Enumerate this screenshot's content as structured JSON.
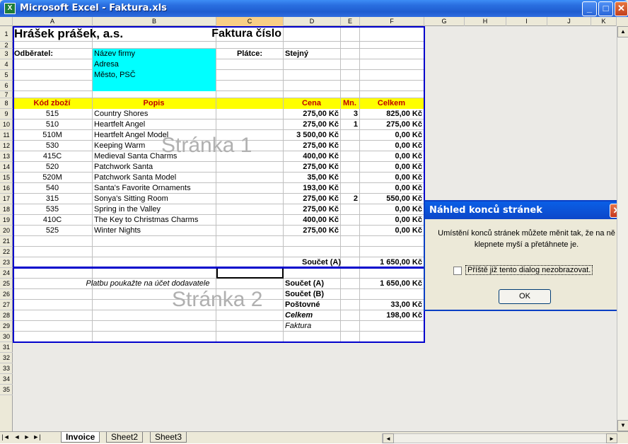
{
  "window": {
    "title": "Microsoft Excel - Faktura.xls",
    "app_icon": "X"
  },
  "columns": [
    "A",
    "B",
    "C",
    "D",
    "E",
    "F",
    "G",
    "H",
    "I",
    "J",
    "K"
  ],
  "rows": [
    "1",
    "2",
    "3",
    "4",
    "5",
    "6",
    "7",
    "8",
    "9",
    "10",
    "11",
    "12",
    "13",
    "14",
    "15",
    "16",
    "17",
    "18",
    "19",
    "20",
    "21",
    "22",
    "23",
    "24",
    "25",
    "26",
    "27",
    "28",
    "29",
    "30",
    "31",
    "32",
    "33",
    "34",
    "35"
  ],
  "header": {
    "company": "Hrášek prášek, a.s.",
    "invoice_label": "Faktura číslo"
  },
  "customer": {
    "label": "Odběratel:",
    "name": "Název firmy",
    "address": "Adresa",
    "city": "Město, PSČ",
    "payer_label": "Plátce:",
    "payer_value": "Stejný"
  },
  "table": {
    "headers": [
      "Kód zboží",
      "Popis",
      "Cena",
      "Mn.",
      "Celkem"
    ],
    "rows": [
      {
        "code": "515",
        "desc": "Country Shores",
        "price": "275,00 Kč",
        "qty": "3",
        "total": "825,00 Kč"
      },
      {
        "code": "510",
        "desc": "Heartfelt Angel",
        "price": "275,00 Kč",
        "qty": "1",
        "total": "275,00 Kč"
      },
      {
        "code": "510M",
        "desc": "Heartfelt Angel Model",
        "price": "3 500,00 Kč",
        "qty": "",
        "total": "0,00 Kč"
      },
      {
        "code": "530",
        "desc": "Keeping Warm",
        "price": "275,00 Kč",
        "qty": "",
        "total": "0,00 Kč"
      },
      {
        "code": "415C",
        "desc": "Medieval Santa Charms",
        "price": "400,00 Kč",
        "qty": "",
        "total": "0,00 Kč"
      },
      {
        "code": "520",
        "desc": "Patchwork Santa",
        "price": "275,00 Kč",
        "qty": "",
        "total": "0,00 Kč"
      },
      {
        "code": "520M",
        "desc": "Patchwork Santa Model",
        "price": "35,00 Kč",
        "qty": "",
        "total": "0,00 Kč"
      },
      {
        "code": "540",
        "desc": "Santa's Favorite Ornaments",
        "price": "193,00 Kč",
        "qty": "",
        "total": "0,00 Kč"
      },
      {
        "code": "315",
        "desc": "Sonya's Sitting Room",
        "price": "275,00 Kč",
        "qty": "2",
        "total": "550,00 Kč"
      },
      {
        "code": "535",
        "desc": "Spring in the Valley",
        "price": "275,00 Kč",
        "qty": "",
        "total": "0,00 Kč"
      },
      {
        "code": "410C",
        "desc": "The Key to Christmas Charms",
        "price": "400,00 Kč",
        "qty": "",
        "total": "0,00 Kč"
      },
      {
        "code": "525",
        "desc": "Winter Nights",
        "price": "275,00 Kč",
        "qty": "",
        "total": "0,00 Kč"
      }
    ]
  },
  "subtotal": {
    "label": "Součet (A)",
    "value": "1 650,00 Kč"
  },
  "footer": {
    "payment_note": "Platbu poukažte na účet dodavatele",
    "sum_a_label": "Součet (A)",
    "sum_a_value": "1 650,00 Kč",
    "sum_b_label": "Součet (B)",
    "postage_label": "Poštovné",
    "postage_value": "33,00 Kč",
    "total_label": "Celkem",
    "total_value": "198,00 Kč",
    "faktura_label": "Faktura"
  },
  "watermarks": {
    "page1": "Stránka 1",
    "page2": "Stránka 2"
  },
  "dialog": {
    "title": "Náhled konců stránek",
    "message": "Umístění konců stránek můžete měnit tak, že na ně klepnete myší a přetáhnete je.",
    "checkbox_label": "Příště již tento dialog nezobrazovat.",
    "ok_label": "OK"
  },
  "sheets": [
    "Invoice",
    "Sheet2",
    "Sheet3"
  ],
  "colors": {
    "accent_yellow": "#ffff00",
    "accent_cyan": "#00ffff",
    "print_border": "#0000cc"
  }
}
